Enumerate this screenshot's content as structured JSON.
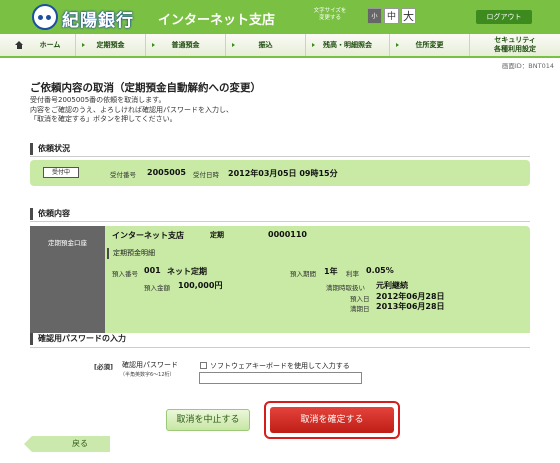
{
  "header": {
    "bank_name": "紀陽銀行",
    "branch_name": "インターネット支店",
    "font_size_label": "文字サイズを\n変更する",
    "font_sizes": {
      "small": "小",
      "medium": "中",
      "large": "大"
    },
    "logout": "ログアウト"
  },
  "nav": [
    {
      "label": "ホーム"
    },
    {
      "label": "定期預金"
    },
    {
      "label": "普通預金"
    },
    {
      "label": "振込"
    },
    {
      "label": "残高・明細照会"
    },
    {
      "label": "住所変更"
    },
    {
      "label": "セキュリティ",
      "label2": "各種利用設定"
    }
  ],
  "screen_id": "画面ID：BNT014",
  "page": {
    "title": "ご依頼内容の取消（定期預金自動解約への変更）",
    "intro": [
      "受付番号2005005番の依頼を取消します。",
      "内容をご確認のうえ、よろしければ確認用パスワードを入力し、",
      "「取消を確定する」ボタンを押してください。"
    ]
  },
  "status": {
    "heading": "依頼状況",
    "badge": "受付中",
    "receipt_no_label": "受付番号",
    "receipt_no": "2005005",
    "receipt_date_label": "受付日時",
    "receipt_date": "2012年03月05日 09時15分"
  },
  "details": {
    "heading": "依頼内容",
    "account_label": "定期預金口座",
    "branch": "インターネット支店",
    "account_type": "定期",
    "account_no": "0000110",
    "sub_heading": "定期預金明細",
    "deposit_no_label": "預入番号",
    "deposit_no": "001",
    "product": "ネット定期",
    "amount_label": "預入金額",
    "amount": "100,000円",
    "term_label": "預入期間",
    "term": "1年",
    "rate_label": "利率",
    "rate": "0.05%",
    "maturity_handling_label": "満期時取扱い",
    "maturity_handling": "元利継続",
    "deposit_date_label": "預入日",
    "deposit_date": "2012年06月28日",
    "maturity_date_label": "満期日",
    "maturity_date": "2013年06月28日"
  },
  "password": {
    "heading": "確認用パスワードの入力",
    "required": "[必須]",
    "label": "確認用パスワード",
    "hint": "（半角英数字6～12桁）",
    "keyboard_checkbox": "ソフトウェアキーボードを使用して入力する",
    "value": ""
  },
  "buttons": {
    "cancel": "取消を中止する",
    "confirm": "取消を確定する",
    "back": "戻る"
  }
}
